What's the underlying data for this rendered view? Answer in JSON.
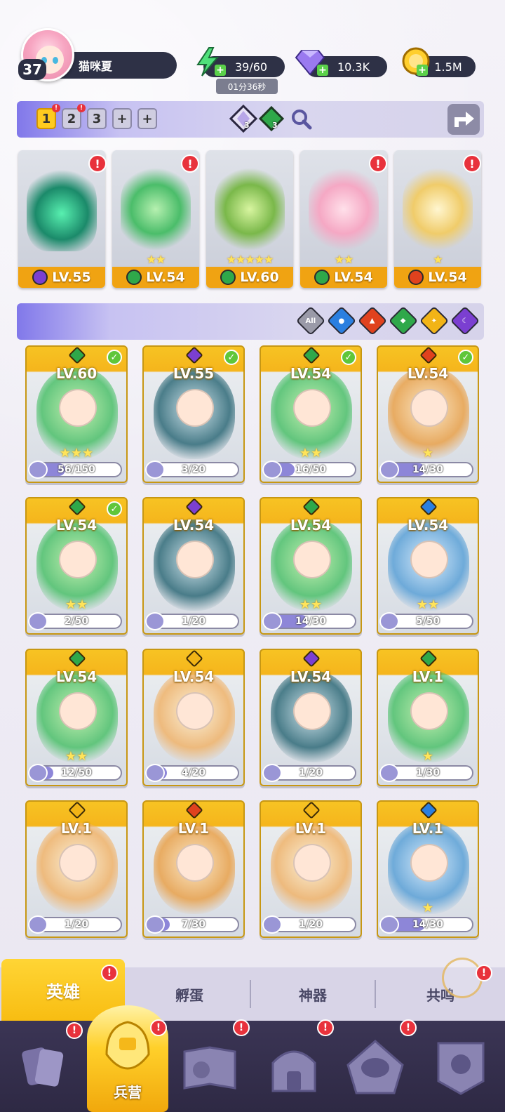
{
  "player": {
    "level": "37",
    "name": "猫咪夏"
  },
  "resources": {
    "energy": "39/60",
    "energy_timer": "01分36秒",
    "gems": "10.3K",
    "coins": "1.5M"
  },
  "team_slots": {
    "slots": [
      "1",
      "2",
      "3",
      "+",
      "+"
    ],
    "active": "1",
    "tokens": [
      {
        "count": "3"
      },
      {
        "count": "3"
      }
    ]
  },
  "team": [
    {
      "level": "LV.55",
      "element": "dark",
      "stars": "",
      "alert": "!"
    },
    {
      "level": "LV.54",
      "element": "nature",
      "stars": "★★",
      "alert": "!"
    },
    {
      "level": "LV.60",
      "element": "nature",
      "stars": "★★★★★",
      "alert": ""
    },
    {
      "level": "LV.54",
      "element": "nature",
      "stars": "★★",
      "alert": "!"
    },
    {
      "level": "LV.54",
      "element": "fire",
      "stars": "★",
      "alert": "!"
    }
  ],
  "filters": {
    "all_label": "All",
    "elements": [
      "water",
      "fire",
      "nature",
      "light",
      "dark"
    ]
  },
  "heroes": [
    {
      "level": "LV.60",
      "element": "nature",
      "fragments": "56/150",
      "progress": 0.37,
      "equipped": true,
      "stars": "★★★"
    },
    {
      "level": "LV.55",
      "element": "dark",
      "fragments": "3/20",
      "progress": 0.15,
      "equipped": true,
      "stars": ""
    },
    {
      "level": "LV.54",
      "element": "nature",
      "fragments": "16/50",
      "progress": 0.32,
      "equipped": true,
      "stars": "★★"
    },
    {
      "level": "LV.54",
      "element": "fire",
      "fragments": "14/30",
      "progress": 0.47,
      "equipped": true,
      "stars": "★"
    },
    {
      "level": "LV.54",
      "element": "nature",
      "fragments": "2/50",
      "progress": 0.04,
      "equipped": true,
      "stars": "★★"
    },
    {
      "level": "LV.54",
      "element": "dark",
      "fragments": "1/20",
      "progress": 0.05,
      "equipped": false,
      "stars": ""
    },
    {
      "level": "LV.54",
      "element": "nature",
      "fragments": "14/30",
      "progress": 0.47,
      "equipped": false,
      "stars": "★★"
    },
    {
      "level": "LV.54",
      "element": "water",
      "fragments": "5/50",
      "progress": 0.1,
      "equipped": false,
      "stars": "★★"
    },
    {
      "level": "LV.54",
      "element": "nature",
      "fragments": "12/50",
      "progress": 0.24,
      "equipped": false,
      "stars": "★★"
    },
    {
      "level": "LV.54",
      "element": "light",
      "fragments": "4/20",
      "progress": 0.2,
      "equipped": false,
      "stars": ""
    },
    {
      "level": "LV.54",
      "element": "dark",
      "fragments": "1/20",
      "progress": 0.05,
      "equipped": false,
      "stars": ""
    },
    {
      "level": "LV.1",
      "element": "nature",
      "fragments": "1/30",
      "progress": 0.03,
      "equipped": false,
      "stars": "★"
    },
    {
      "level": "LV.1",
      "element": "light",
      "fragments": "1/20",
      "progress": 0.05,
      "equipped": false,
      "stars": ""
    },
    {
      "level": "LV.1",
      "element": "fire",
      "fragments": "7/30",
      "progress": 0.23,
      "equipped": false,
      "stars": ""
    },
    {
      "level": "LV.1",
      "element": "light",
      "fragments": "1/20",
      "progress": 0.05,
      "equipped": false,
      "stars": ""
    },
    {
      "level": "LV.1",
      "element": "water",
      "fragments": "14/30",
      "progress": 0.47,
      "equipped": false,
      "stars": "★"
    }
  ],
  "subtabs": {
    "heroes": "英雄",
    "incubate": "孵蛋",
    "artifacts": "神器",
    "resonance": "共鸣"
  },
  "bottom_nav": {
    "active_label": "兵营",
    "alert": "!"
  },
  "colors": {
    "nature": "#2fa84a",
    "dark": "#7b3fd1",
    "fire": "#e0421e",
    "water": "#2a7fe0",
    "light": "#f2b416",
    "accent": "#f8bd12"
  }
}
